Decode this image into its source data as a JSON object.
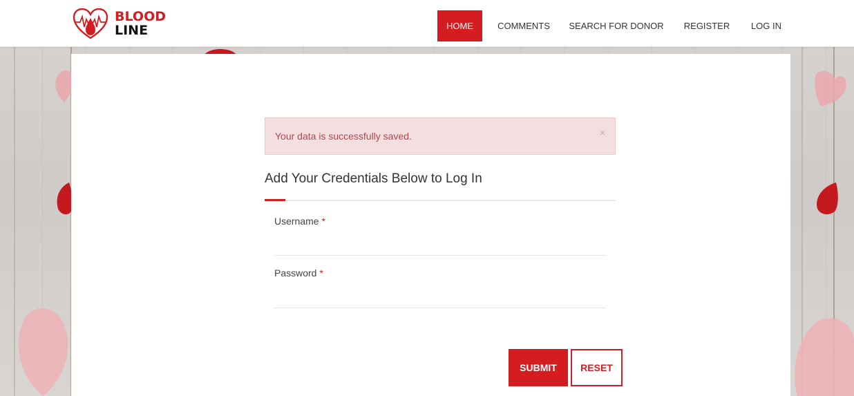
{
  "brand": {
    "line1": "BLOOD",
    "line2": "LINE",
    "accent_color": "#d31d20"
  },
  "nav": {
    "items": [
      {
        "label": "HOME",
        "active": true
      },
      {
        "label": "COMMENTS",
        "active": false
      },
      {
        "label": "SEARCH FOR DONOR",
        "active": false
      },
      {
        "label": "REGISTER",
        "active": false
      },
      {
        "label": "LOG IN",
        "active": false
      }
    ]
  },
  "alert": {
    "message": "Your data is successfully saved.",
    "close_symbol": "×"
  },
  "form": {
    "title": "Add Your Credentials Below to Log In",
    "username_label": "Username",
    "password_label": "Password",
    "required_mark": "*",
    "username_value": "",
    "password_value": "",
    "submit_label": "SUBMIT",
    "reset_label": "RESET"
  }
}
